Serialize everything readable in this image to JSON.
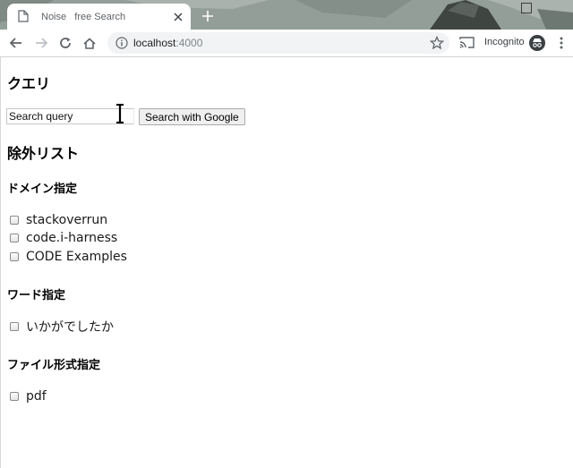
{
  "browser": {
    "tab_title": "Noise   free Search",
    "url_host": "localhost",
    "url_port": ":4000",
    "incognito_label": "Incognito"
  },
  "page": {
    "query_heading": "クエリ",
    "search_placeholder": "Search query",
    "search_value": "",
    "search_button": "Search with Google",
    "exclude_heading": "除外リスト",
    "domain_heading": "ドメイン指定",
    "domains": [
      {
        "label": "stackoverrun",
        "checked": false
      },
      {
        "label": "code.i-harness",
        "checked": false
      },
      {
        "label": "CODE Examples",
        "checked": false
      }
    ],
    "word_heading": "ワード指定",
    "words": [
      {
        "label": "いかがでしたか",
        "checked": false
      }
    ],
    "filetype_heading": "ファイル形式指定",
    "filetypes": [
      {
        "label": "pdf",
        "checked": false
      }
    ]
  },
  "icons": {
    "back": "arrow-left-icon",
    "forward": "arrow-right-icon",
    "reload": "reload-icon",
    "home": "home-icon",
    "info": "info-icon",
    "bookmark": "star-icon",
    "cast": "cast-icon",
    "incognito": "incognito-icon",
    "menu": "kebab-menu-icon"
  }
}
